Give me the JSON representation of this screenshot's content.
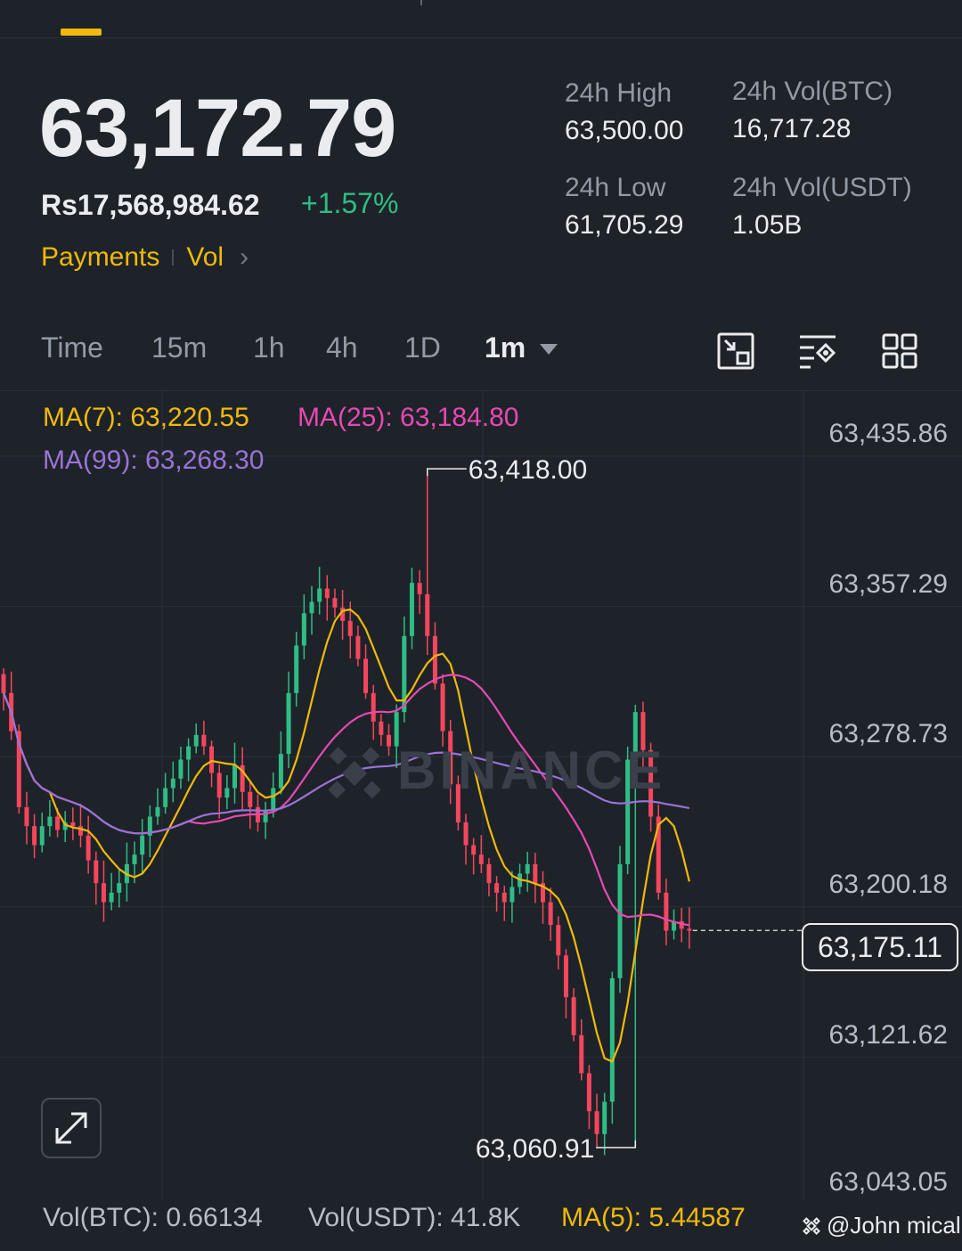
{
  "ticker": {
    "last_price": "63,172.79",
    "fiat_price": "Rs17,568,984.62",
    "change_pct": "+1.57%",
    "links": [
      "Payments",
      "Vol"
    ]
  },
  "stats": {
    "high_label": "24h High",
    "high_value": "63,500.00",
    "low_label": "24h Low",
    "low_value": "61,705.29",
    "vol_btc_label": "24h Vol(BTC)",
    "vol_btc_value": "16,717.28",
    "vol_usdt_label": "24h Vol(USDT)",
    "vol_usdt_value": "1.05B"
  },
  "intervals": [
    "Time",
    "15m",
    "1h",
    "4h",
    "1D",
    "1m"
  ],
  "active_interval": "1m",
  "tool_icons": [
    "chart-fullscreen-icon",
    "chart-settings-icon",
    "grid-layout-icon"
  ],
  "ma_legend": {
    "ma7": "MA(7): 63,220.55",
    "ma25": "MA(25): 63,184.80",
    "ma99": "MA(99): 63,268.30"
  },
  "colors": {
    "up": "#2ebd85",
    "down": "#f6465d",
    "ma7": "#f0b90b",
    "ma25": "#e649b3",
    "ma99": "#9a73d6",
    "accent": "#f0b90b"
  },
  "chart_data": {
    "type": "candlestick",
    "ylim": [
      63043.05,
      63435.86
    ],
    "y_ticks": [
      "63,435.86",
      "63,357.29",
      "63,278.73",
      "63,200.18",
      "63,121.62",
      "63,043.05"
    ],
    "current_price_label": "63,175.11",
    "current_price": 63175.11,
    "high_marker": {
      "label": "63,418.00",
      "value": 63418.0
    },
    "low_marker": {
      "label": "63,060.91",
      "value": 63060.91
    },
    "close": [
      63300,
      63280,
      63240,
      63230,
      63220,
      63230,
      63235,
      63228,
      63232,
      63230,
      63225,
      63212,
      63200,
      63190,
      63195,
      63200,
      63210,
      63215,
      63225,
      63235,
      63240,
      63250,
      63255,
      63265,
      63272,
      63278,
      63272,
      63258,
      63245,
      63250,
      63262,
      63248,
      63240,
      63232,
      63238,
      63250,
      63268,
      63300,
      63325,
      63342,
      63348,
      63355,
      63350,
      63345,
      63338,
      63330,
      63318,
      63300,
      63285,
      63278,
      63272,
      63290,
      63330,
      63358,
      63352,
      63330,
      63305,
      63280,
      63252,
      63232,
      63220,
      63215,
      63210,
      63200,
      63195,
      63190,
      63198,
      63205,
      63210,
      63200,
      63190,
      63178,
      63162,
      63140,
      63120,
      63100,
      63080,
      63068,
      63085,
      63150,
      63210,
      63265,
      63290,
      63270,
      63235,
      63195,
      63175,
      63180,
      63176,
      63175
    ]
  },
  "volume": {
    "vol_btc": "Vol(BTC): 0.66134",
    "vol_usdt": "Vol(USDT): 41.8K",
    "ma5": "MA(5): 5.44587"
  },
  "watermark_user": "@John mical",
  "watermark_brand": "BINANCE"
}
